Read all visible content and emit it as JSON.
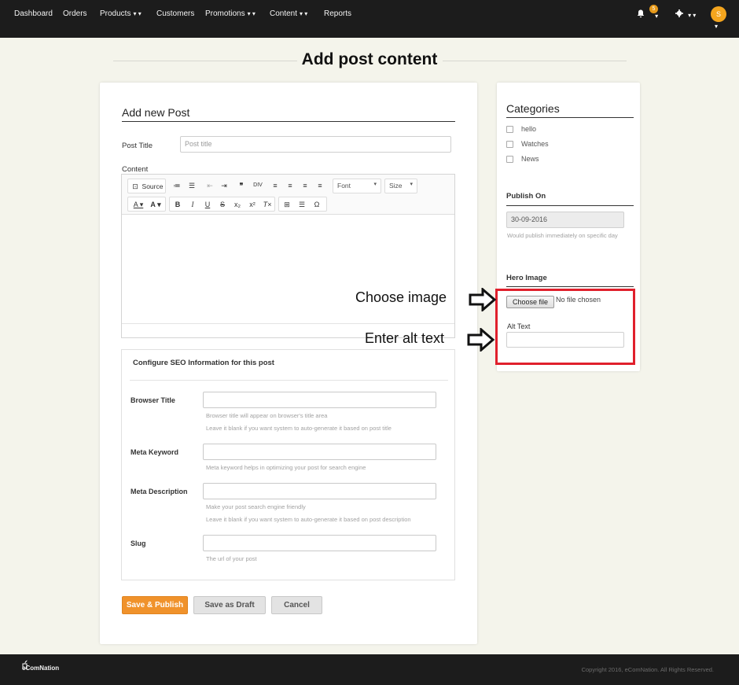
{
  "nav": {
    "items": [
      "Dashboard",
      "Orders",
      "Products",
      "Customers",
      "Promotions",
      "Content",
      "Reports"
    ],
    "notification_count": "5",
    "avatar_initial": "S"
  },
  "page": {
    "title": "Add post content"
  },
  "post": {
    "heading": "Add new Post",
    "title_label": "Post Title",
    "title_placeholder": "Post title",
    "content_label": "Content"
  },
  "editor": {
    "source_label": "Source",
    "font_label": "Font",
    "size_label": "Size"
  },
  "seo": {
    "heading": "Configure SEO Information for this post",
    "browser_title_label": "Browser Title",
    "browser_title_help1": "Browser title will appear on browser's title area",
    "browser_title_help2": "Leave it blank if you want system to auto-generate it based on post title",
    "meta_keyword_label": "Meta Keyword",
    "meta_keyword_help": "Meta keyword helps in optimizing your post for search engine",
    "meta_description_label": "Meta Description",
    "meta_description_help1": "Make your post search engine friendly",
    "meta_description_help2": "Leave it blank if you want system to auto-generate it based on post description",
    "slug_label": "Slug",
    "slug_help": "The url of your post"
  },
  "actions": {
    "save_publish": "Save & Publish",
    "save_draft": "Save as Draft",
    "cancel": "Cancel"
  },
  "sidebar": {
    "categories_heading": "Categories",
    "categories": [
      "hello",
      "Watches",
      "News"
    ],
    "publish_heading": "Publish On",
    "publish_date": "30-09-2016",
    "publish_help": "Would publish immediately on specific day",
    "hero_heading": "Hero Image",
    "choose_file": "Choose file",
    "no_file": "No file chosen",
    "alt_text_label": "Alt Text"
  },
  "annotations": {
    "choose_image": "Choose image",
    "enter_alt_text": "Enter alt text"
  },
  "footer": {
    "brand": "eComNation",
    "copyright": "Copyright 2016, eComNation. All Rights Reserved."
  },
  "colors": {
    "nav_bg": "#1c1c1c",
    "page_bg": "#f4f4eb",
    "primary": "#f0922b",
    "annotation": "#e0202c",
    "badge": "#e69a1a"
  },
  "icons": [
    "bell-icon",
    "gear-icon",
    "chevron-down-icon",
    "arrow-right-icon"
  ]
}
